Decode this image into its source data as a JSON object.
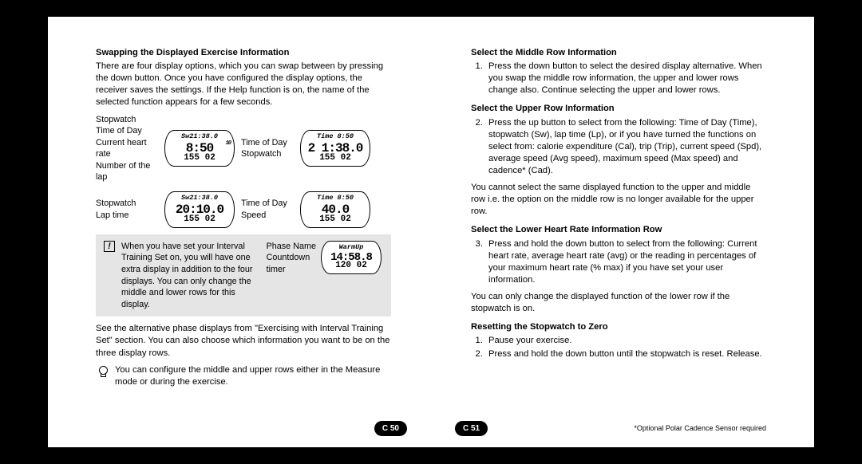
{
  "left": {
    "h1": "Swapping the Displayed Exercise Information",
    "intro": "There are four display options, which you can swap between by pressing the down button. Once you have configured the display options, the receiver saves the settings. If the Help function is on, the name of the selected function appears for a few seconds.",
    "grid": {
      "r1c1": [
        "Stopwatch",
        "Time of Day",
        "Current heart rate",
        "Number of the lap"
      ],
      "r1c2": {
        "top": "Sw21:38.0",
        "mid": "8:50",
        "midSub": "10",
        "bot": "155 02"
      },
      "r1c3": [
        "Time of Day",
        "Stopwatch"
      ],
      "r1c4": {
        "top": "Time 8:50",
        "mid": "2 1:38.0",
        "bot": "155 02"
      },
      "r2c1": [
        "Stopwatch",
        "Lap time"
      ],
      "r2c2": {
        "top": "Sw21:38.0",
        "mid": "20:10.0",
        "bot": "155 02"
      },
      "r2c3": [
        "Time of Day",
        "Speed"
      ],
      "r2c4": {
        "top": "Time 8:50",
        "mid": "40.0",
        "bot": "155 02"
      }
    },
    "note": {
      "body": "When you have set your Interval Training Set on, you will have one extra display in addition to the four displays. You can only change the middle and lower rows for this display.",
      "right": [
        "Phase Name",
        "Countdown",
        "timer"
      ],
      "watch": {
        "top": "WarmUp",
        "mid": "14:58.8",
        "bot": "120 02"
      }
    },
    "p2": "See the alternative phase displays from \"Exercising with Interval Training Set\" section. You can also choose which information you want to be on the three display rows.",
    "tip": "You can configure the middle and upper rows either in the Measure mode or during the exercise.",
    "pagenum": "C 50"
  },
  "right": {
    "h1": "Select the Middle Row Information",
    "li1": "Press the down button to select the desired display alternative. When you swap the middle row information, the upper and lower rows change also. Continue selecting the upper and lower rows.",
    "h2": "Select the Upper Row Information",
    "li2": "Press the up button to select from the following: Time of Day (Time), stopwatch (Sw), lap time (Lp), or if you have turned the functions on select from: calorie expenditure (Cal), trip (Trip), current speed (Spd), average speed (Avg speed), maximum speed (Max speed) and cadence* (Cad).",
    "p1": "You cannot select the same displayed function to the upper and middle row i.e. the option on the middle row is no longer available for the upper row.",
    "h3": "Select the Lower Heart Rate Information Row",
    "li3": "Press and hold the down button to select from the following: Current heart rate, average heart rate (avg) or the reading in percentages of your maximum heart rate (% max) if you have set your user information.",
    "p2": "You can only change the displayed function of the lower row if the stopwatch is on.",
    "h4": "Resetting the Stopwatch to Zero",
    "li4a": "Pause your exercise.",
    "li4b": "Press and hold the down button until the stopwatch is reset. Release.",
    "footnote": "*Optional Polar Cadence Sensor required",
    "pagenum": "C 51"
  }
}
